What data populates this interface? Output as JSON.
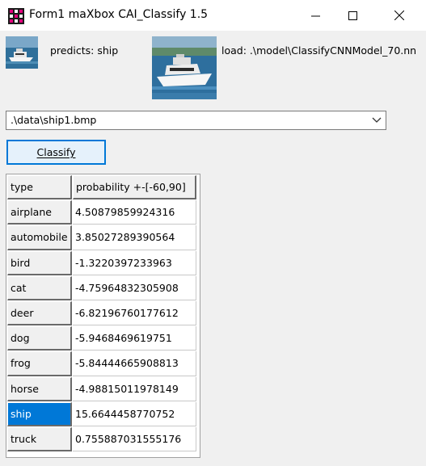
{
  "window": {
    "title": "Form1 maXbox CAI_Classify 1.5",
    "icons": {
      "app": "maxbox-grid-icon",
      "minimize": "minimize-icon",
      "maximize": "maximize-icon",
      "close": "close-icon"
    }
  },
  "prediction": {
    "predicts_text": "predicts: ship",
    "load_text": "load: .\\model\\ClassifyCNNModel_70.nn"
  },
  "images": {
    "small": "ship-thumbnail",
    "large": "ship-preview"
  },
  "file_combo": {
    "value": ".\\data\\ship1.bmp",
    "arrow_icon": "chevron-down-icon"
  },
  "classify_button": {
    "label": "Classify"
  },
  "grid": {
    "headers": [
      "type",
      "probability +-[-60,90]"
    ],
    "rows": [
      {
        "type": "airplane",
        "probability": "4.50879859924316"
      },
      {
        "type": "automobile",
        "probability": "3.85027289390564"
      },
      {
        "type": "bird",
        "probability": "-1.3220397233963"
      },
      {
        "type": "cat",
        "probability": "-4.75964832305908"
      },
      {
        "type": "deer",
        "probability": "-6.82196760177612"
      },
      {
        "type": "dog",
        "probability": "-5.9468469619751"
      },
      {
        "type": "frog",
        "probability": "-5.84444665908813"
      },
      {
        "type": "horse",
        "probability": "-4.98815011978149"
      },
      {
        "type": "ship",
        "probability": "15.6644458770752"
      },
      {
        "type": "truck",
        "probability": "0.755887031555176"
      }
    ],
    "selected_row": "ship",
    "selection_color": "#0078d7"
  }
}
